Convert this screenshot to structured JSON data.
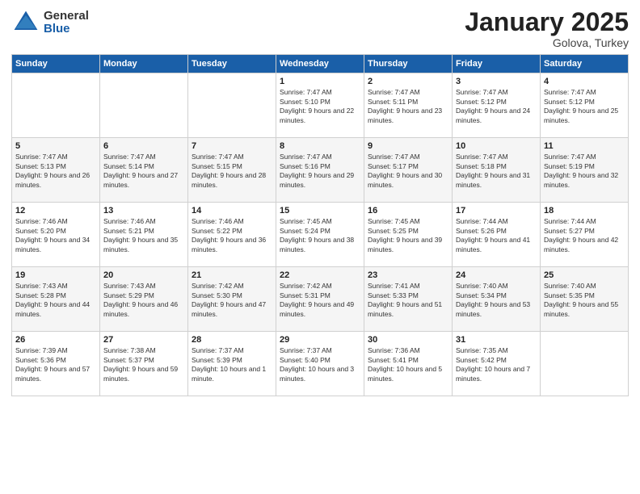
{
  "logo": {
    "general": "General",
    "blue": "Blue"
  },
  "title": "January 2025",
  "subtitle": "Golova, Turkey",
  "days_of_week": [
    "Sunday",
    "Monday",
    "Tuesday",
    "Wednesday",
    "Thursday",
    "Friday",
    "Saturday"
  ],
  "weeks": [
    [
      {
        "day": "",
        "text": ""
      },
      {
        "day": "",
        "text": ""
      },
      {
        "day": "",
        "text": ""
      },
      {
        "day": "1",
        "text": "Sunrise: 7:47 AM\nSunset: 5:10 PM\nDaylight: 9 hours and 22 minutes."
      },
      {
        "day": "2",
        "text": "Sunrise: 7:47 AM\nSunset: 5:11 PM\nDaylight: 9 hours and 23 minutes."
      },
      {
        "day": "3",
        "text": "Sunrise: 7:47 AM\nSunset: 5:12 PM\nDaylight: 9 hours and 24 minutes."
      },
      {
        "day": "4",
        "text": "Sunrise: 7:47 AM\nSunset: 5:12 PM\nDaylight: 9 hours and 25 minutes."
      }
    ],
    [
      {
        "day": "5",
        "text": "Sunrise: 7:47 AM\nSunset: 5:13 PM\nDaylight: 9 hours and 26 minutes."
      },
      {
        "day": "6",
        "text": "Sunrise: 7:47 AM\nSunset: 5:14 PM\nDaylight: 9 hours and 27 minutes."
      },
      {
        "day": "7",
        "text": "Sunrise: 7:47 AM\nSunset: 5:15 PM\nDaylight: 9 hours and 28 minutes."
      },
      {
        "day": "8",
        "text": "Sunrise: 7:47 AM\nSunset: 5:16 PM\nDaylight: 9 hours and 29 minutes."
      },
      {
        "day": "9",
        "text": "Sunrise: 7:47 AM\nSunset: 5:17 PM\nDaylight: 9 hours and 30 minutes."
      },
      {
        "day": "10",
        "text": "Sunrise: 7:47 AM\nSunset: 5:18 PM\nDaylight: 9 hours and 31 minutes."
      },
      {
        "day": "11",
        "text": "Sunrise: 7:47 AM\nSunset: 5:19 PM\nDaylight: 9 hours and 32 minutes."
      }
    ],
    [
      {
        "day": "12",
        "text": "Sunrise: 7:46 AM\nSunset: 5:20 PM\nDaylight: 9 hours and 34 minutes."
      },
      {
        "day": "13",
        "text": "Sunrise: 7:46 AM\nSunset: 5:21 PM\nDaylight: 9 hours and 35 minutes."
      },
      {
        "day": "14",
        "text": "Sunrise: 7:46 AM\nSunset: 5:22 PM\nDaylight: 9 hours and 36 minutes."
      },
      {
        "day": "15",
        "text": "Sunrise: 7:45 AM\nSunset: 5:24 PM\nDaylight: 9 hours and 38 minutes."
      },
      {
        "day": "16",
        "text": "Sunrise: 7:45 AM\nSunset: 5:25 PM\nDaylight: 9 hours and 39 minutes."
      },
      {
        "day": "17",
        "text": "Sunrise: 7:44 AM\nSunset: 5:26 PM\nDaylight: 9 hours and 41 minutes."
      },
      {
        "day": "18",
        "text": "Sunrise: 7:44 AM\nSunset: 5:27 PM\nDaylight: 9 hours and 42 minutes."
      }
    ],
    [
      {
        "day": "19",
        "text": "Sunrise: 7:43 AM\nSunset: 5:28 PM\nDaylight: 9 hours and 44 minutes."
      },
      {
        "day": "20",
        "text": "Sunrise: 7:43 AM\nSunset: 5:29 PM\nDaylight: 9 hours and 46 minutes."
      },
      {
        "day": "21",
        "text": "Sunrise: 7:42 AM\nSunset: 5:30 PM\nDaylight: 9 hours and 47 minutes."
      },
      {
        "day": "22",
        "text": "Sunrise: 7:42 AM\nSunset: 5:31 PM\nDaylight: 9 hours and 49 minutes."
      },
      {
        "day": "23",
        "text": "Sunrise: 7:41 AM\nSunset: 5:33 PM\nDaylight: 9 hours and 51 minutes."
      },
      {
        "day": "24",
        "text": "Sunrise: 7:40 AM\nSunset: 5:34 PM\nDaylight: 9 hours and 53 minutes."
      },
      {
        "day": "25",
        "text": "Sunrise: 7:40 AM\nSunset: 5:35 PM\nDaylight: 9 hours and 55 minutes."
      }
    ],
    [
      {
        "day": "26",
        "text": "Sunrise: 7:39 AM\nSunset: 5:36 PM\nDaylight: 9 hours and 57 minutes."
      },
      {
        "day": "27",
        "text": "Sunrise: 7:38 AM\nSunset: 5:37 PM\nDaylight: 9 hours and 59 minutes."
      },
      {
        "day": "28",
        "text": "Sunrise: 7:37 AM\nSunset: 5:39 PM\nDaylight: 10 hours and 1 minute."
      },
      {
        "day": "29",
        "text": "Sunrise: 7:37 AM\nSunset: 5:40 PM\nDaylight: 10 hours and 3 minutes."
      },
      {
        "day": "30",
        "text": "Sunrise: 7:36 AM\nSunset: 5:41 PM\nDaylight: 10 hours and 5 minutes."
      },
      {
        "day": "31",
        "text": "Sunrise: 7:35 AM\nSunset: 5:42 PM\nDaylight: 10 hours and 7 minutes."
      },
      {
        "day": "",
        "text": ""
      }
    ]
  ]
}
